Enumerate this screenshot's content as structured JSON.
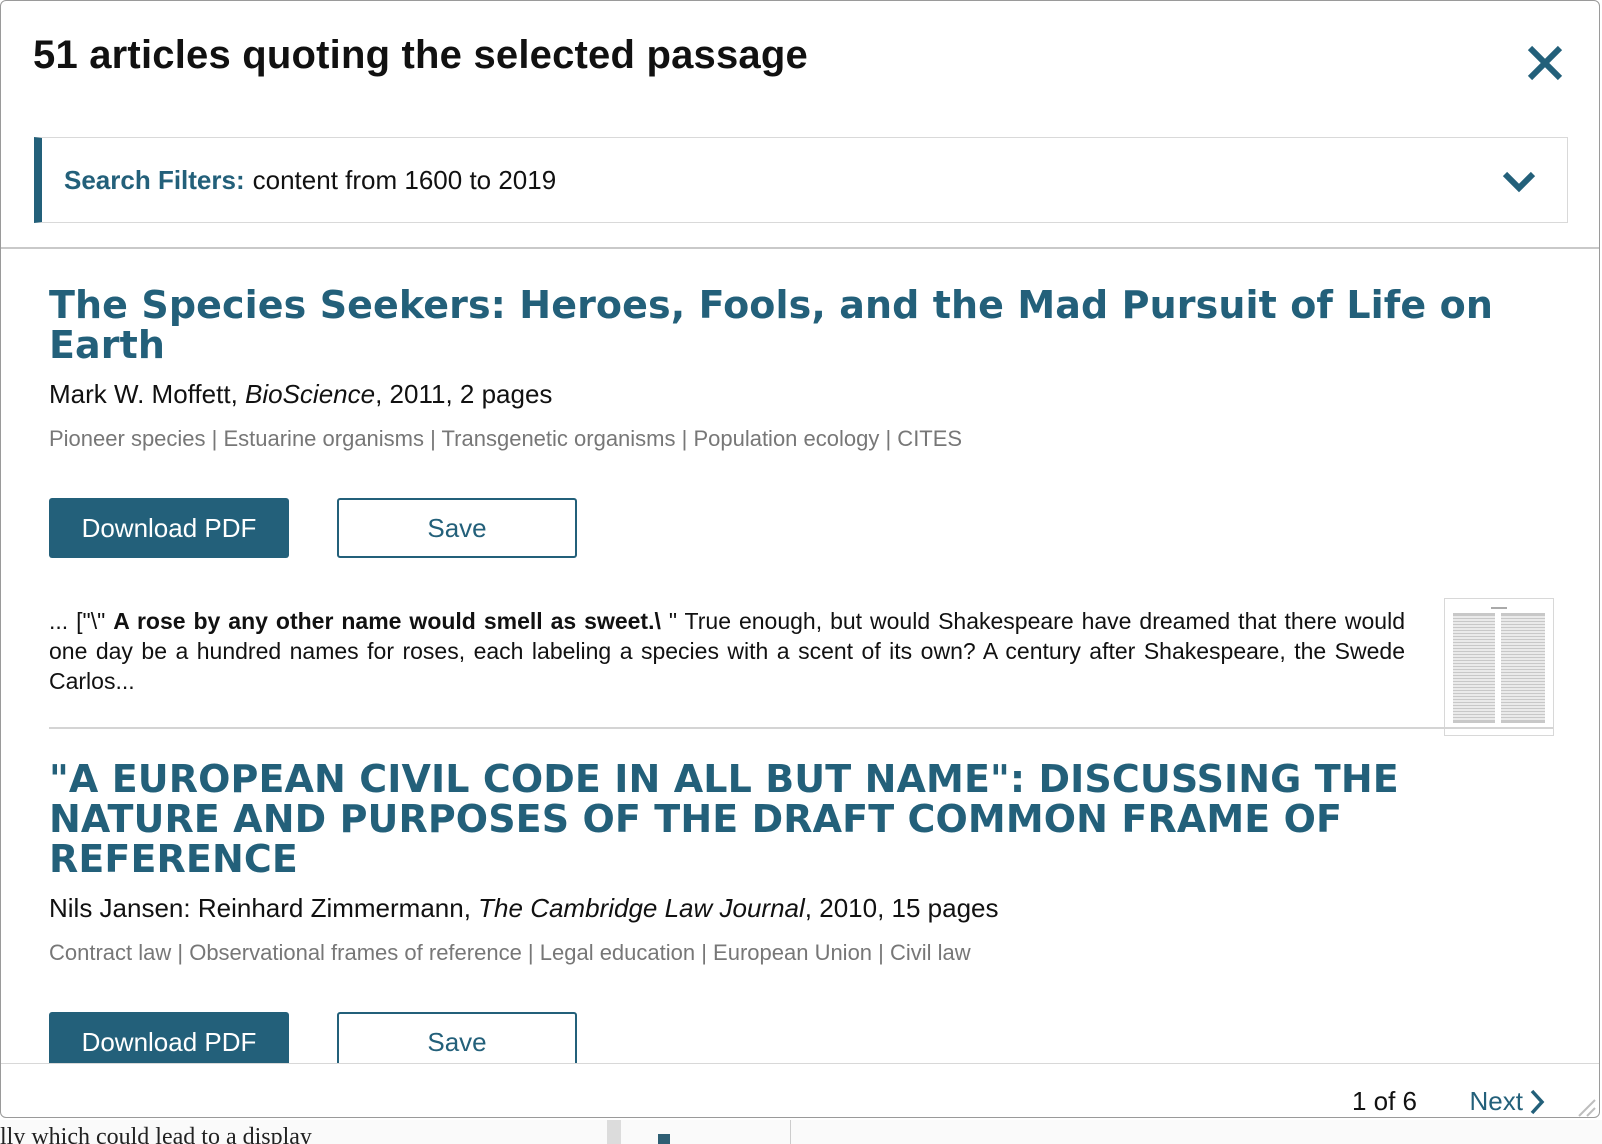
{
  "background": {
    "text": "lly which could lead to a display"
  },
  "modal": {
    "title": "51 articles quoting the selected passage",
    "close_icon": "close-icon",
    "filters": {
      "label": "Search Filters:",
      "value": "content from 1600 to 2019",
      "toggle_icon": "chevron-down-icon"
    },
    "articles": [
      {
        "title": "The Species Seekers: Heroes, Fools, and the Mad Pursuit of Life on Earth",
        "authors": "Mark W. Moffett",
        "journal": "BioScience",
        "details": ", 2011, 2 pages",
        "tags": "Pioneer species | Estuarine organisms | Transgenetic organisms | Population ecology | CITES",
        "download_label": "Download PDF",
        "save_label": "Save",
        "snippet_before": "... [\"\\\" ",
        "snippet_highlight": "A rose by any other name would smell as sweet.\\",
        "snippet_after": " \" True enough, but would Shakespeare have dreamed that there would one day be a hundred names for roses, each labeling a species with a scent of its own? A century after Shakespeare, the Swede Carlos..."
      },
      {
        "title": "\"A EUROPEAN CIVIL CODE IN ALL BUT NAME\": DISCUSSING THE NATURE AND PURPOSES OF THE DRAFT COMMON FRAME OF REFERENCE",
        "authors": "Nils Jansen: Reinhard Zimmermann",
        "journal": "The Cambridge Law Journal",
        "details": ", 2010, 15 pages",
        "tags": "Contract law | Observational frames of reference | Legal education | European Union | Civil law",
        "download_label": "Download PDF",
        "save_label": "Save"
      }
    ],
    "pagination": {
      "status": "1 of 6",
      "next_label": "Next",
      "next_icon": "chevron-right-icon"
    }
  },
  "colors": {
    "accent": "#23607a",
    "tag_text": "#777777",
    "divider": "#d4d4d4"
  }
}
